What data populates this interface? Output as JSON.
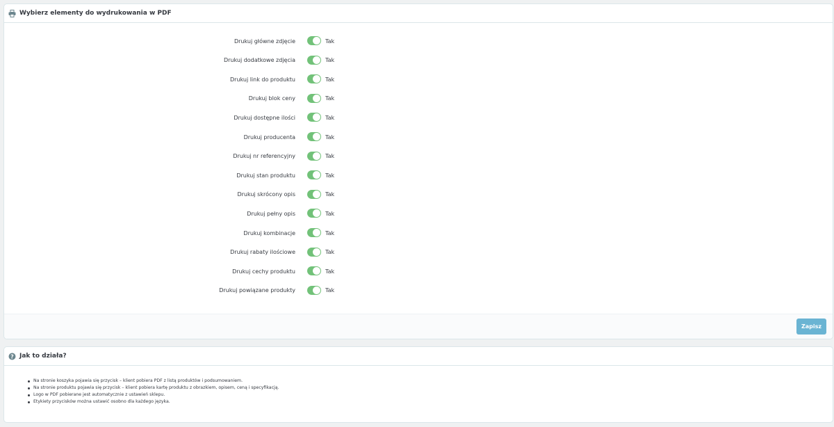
{
  "settings_panel": {
    "title": "Wybierz elementy do wydrukowania w PDF",
    "options": [
      {
        "label": "Drukuj główne zdjęcie",
        "state": "Tak"
      },
      {
        "label": "Drukuj dodatkowe zdjęcia",
        "state": "Tak"
      },
      {
        "label": "Drukuj link do produktu",
        "state": "Tak"
      },
      {
        "label": "Drukuj blok ceny",
        "state": "Tak"
      },
      {
        "label": "Drukuj dostępne ilości",
        "state": "Tak"
      },
      {
        "label": "Drukuj producenta",
        "state": "Tak"
      },
      {
        "label": "Drukuj nr referencyjny",
        "state": "Tak"
      },
      {
        "label": "Drukuj stan produktu",
        "state": "Tak"
      },
      {
        "label": "Drukuj skrócony opis",
        "state": "Tak"
      },
      {
        "label": "Drukuj pełny opis",
        "state": "Tak"
      },
      {
        "label": "Drukuj kombinacje",
        "state": "Tak"
      },
      {
        "label": "Drukuj rabaty ilościowe",
        "state": "Tak"
      },
      {
        "label": "Drukuj cechy produktu",
        "state": "Tak"
      },
      {
        "label": "Drukuj powiązane produkty",
        "state": "Tak"
      }
    ],
    "save_label": "Zapisz"
  },
  "help_panel": {
    "title": "Jak to działa?",
    "items": [
      "Na stronie koszyka pojawia się przycisk – klient pobiera PDF z listą produktów i podsumowaniem.",
      "Na stronie produktu pojawia się przycisk – klient pobiera kartę produktu z obrazkiem, opisem, ceną i specyfikacją.",
      "Logo w PDF pobierane jest automatycznie z ustawień sklepu.",
      "Etykiety przycisków można ustawić osobno dla każdego języka."
    ]
  },
  "colors": {
    "switch_on": "#72c279",
    "save_button": "#6ab4d3",
    "page_background": "#eff1f2"
  },
  "icons": {
    "settings_heading": "printer-icon",
    "help_heading": "question-circle-icon"
  }
}
